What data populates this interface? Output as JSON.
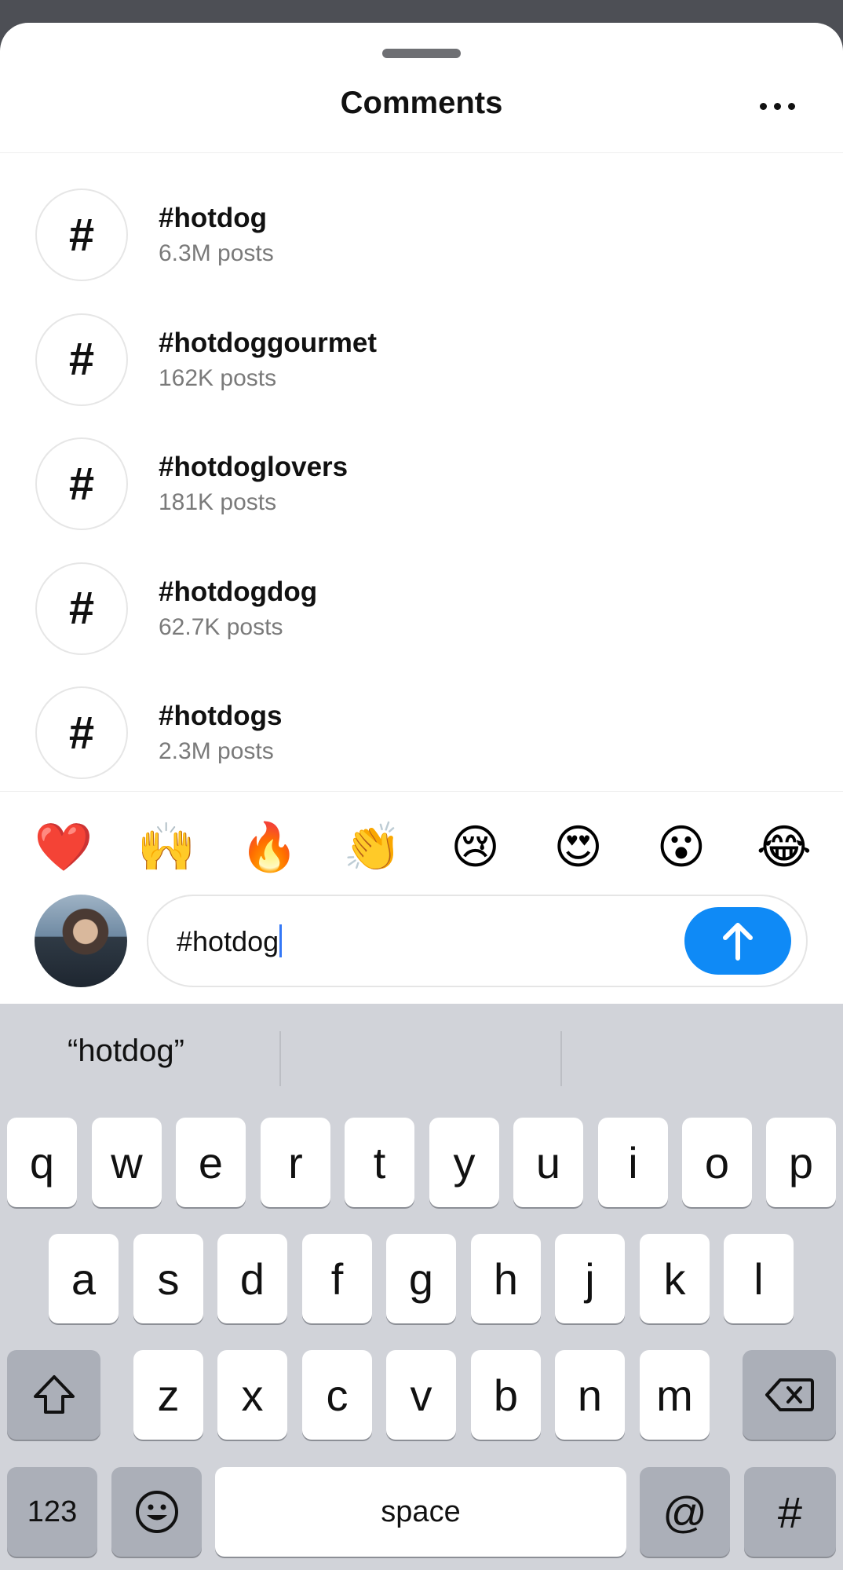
{
  "sheet": {
    "title": "Comments"
  },
  "hashtags": [
    {
      "symbol": "#",
      "name": "#hotdog",
      "count": "6.3M posts"
    },
    {
      "symbol": "#",
      "name": "#hotdoggourmet",
      "count": "162K posts"
    },
    {
      "symbol": "#",
      "name": "#hotdoglovers",
      "count": "181K posts"
    },
    {
      "symbol": "#",
      "name": "#hotdogdog",
      "count": "62.7K posts"
    },
    {
      "symbol": "#",
      "name": "#hotdogs",
      "count": "2.3M posts"
    }
  ],
  "emojis": [
    "❤️",
    "🙌",
    "🔥",
    "👏",
    "😢",
    "😍",
    "😮",
    "😂"
  ],
  "composer": {
    "text": "#hotdog",
    "send_icon": "arrow-up-icon"
  },
  "keyboard": {
    "suggestions": [
      "“hotdog”",
      "",
      ""
    ],
    "row1": [
      "q",
      "w",
      "e",
      "r",
      "t",
      "y",
      "u",
      "i",
      "o",
      "p"
    ],
    "row2": [
      "a",
      "s",
      "d",
      "f",
      "g",
      "h",
      "j",
      "k",
      "l"
    ],
    "row3": [
      "z",
      "x",
      "c",
      "v",
      "b",
      "n",
      "m"
    ],
    "numbers_key": "123",
    "space_key": "space",
    "at_key": "@",
    "hash_key": "#"
  },
  "colors": {
    "accent": "#0f8af6",
    "caret": "#3478f6",
    "keyboard_bg": "#d1d3d9"
  }
}
